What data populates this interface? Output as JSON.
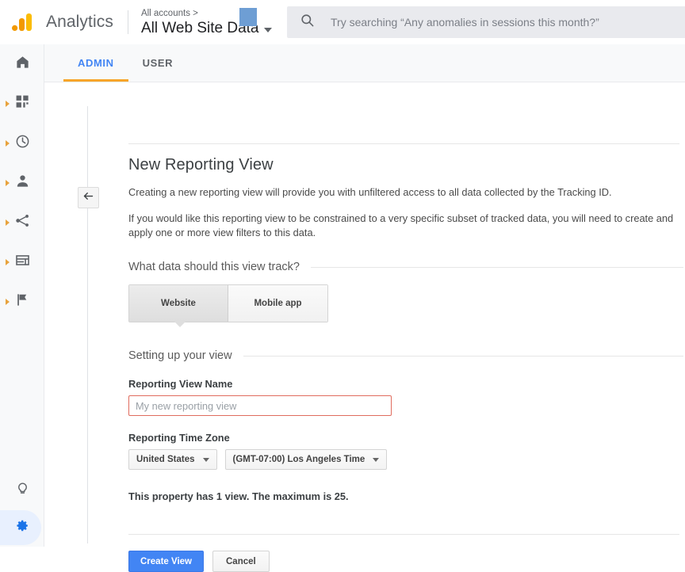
{
  "header": {
    "brand": "Analytics",
    "logo_icon": "analytics-logo-icon",
    "breadcrumb": "All accounts >",
    "account_title": "All Web Site Data",
    "account_caret_icon": "chevron-down-icon",
    "search_icon": "search-icon",
    "search_placeholder": "Try searching “Any anomalies in sessions this month?”",
    "colors": {
      "logo_orange": "#f29900",
      "logo_yellow": "#fbbc04",
      "accent_blue": "#4285f4",
      "tab_underline": "#f7a52a",
      "avatar_blue": "#6e9ed4"
    }
  },
  "sidebar": {
    "items": [
      {
        "name": "home",
        "icon": "home-icon",
        "expandable": false
      },
      {
        "name": "customization",
        "icon": "customization-grid-icon",
        "expandable": true
      },
      {
        "name": "realtime",
        "icon": "clock-icon",
        "expandable": true
      },
      {
        "name": "audience",
        "icon": "person-icon",
        "expandable": true
      },
      {
        "name": "acquisition",
        "icon": "share-nodes-icon",
        "expandable": true
      },
      {
        "name": "behavior",
        "icon": "window-icon",
        "expandable": true
      },
      {
        "name": "conversions",
        "icon": "flag-icon",
        "expandable": true
      }
    ],
    "bottom_items": [
      {
        "name": "discover",
        "icon": "lightbulb-icon",
        "active": false
      },
      {
        "name": "admin",
        "icon": "gear-icon",
        "active": true
      }
    ]
  },
  "tabs": [
    {
      "label": "ADMIN",
      "active": true
    },
    {
      "label": "USER",
      "active": false
    }
  ],
  "back_button": {
    "icon": "back-arrow-icon"
  },
  "main": {
    "title": "New Reporting View",
    "paragraph_1": "Creating a new reporting view will provide you with unfiltered access to all data collected by the Tracking ID.",
    "paragraph_2": "If you would like this reporting view to be constrained to a very specific subset of tracked data, you will need to create and apply one or more view filters to this data.",
    "track_legend": "What data should this view track?",
    "track_options": [
      {
        "label": "Website",
        "selected": true
      },
      {
        "label": "Mobile app",
        "selected": false
      }
    ],
    "setup_legend": "Setting up your view",
    "view_name_label": "Reporting View Name",
    "view_name_value": "",
    "view_name_placeholder": "My new reporting view",
    "time_zone_label": "Reporting Time Zone",
    "time_zone_country": "United States",
    "time_zone_offset": "(GMT-07:00) Los Angeles Time",
    "quota_note": "This property has 1 view. The maximum is 25.",
    "create_button": "Create View",
    "cancel_button": "Cancel"
  }
}
